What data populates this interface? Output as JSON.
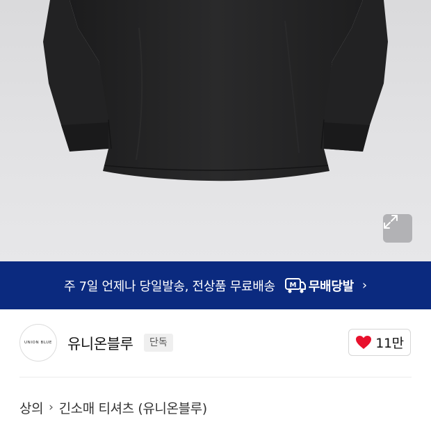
{
  "hero": {
    "expand_icon": "expand-icon"
  },
  "banner": {
    "text": "주 7일 언제나 당일발송, 전상품 무료배송",
    "logo_icon": "m-truck-icon",
    "logo_text": "무배당발",
    "chevron": "›",
    "background": "#0b2a7f"
  },
  "brand": {
    "logo_text": "UNION BLUE",
    "name": "유니온블루",
    "badge": "단독",
    "like_icon": "heart-icon",
    "like_count": "11만",
    "like_color": "#e8112d"
  },
  "breadcrumb": {
    "items": [
      "상의",
      "긴소매 티셔츠 (유니온블루)"
    ],
    "separator": "›"
  }
}
